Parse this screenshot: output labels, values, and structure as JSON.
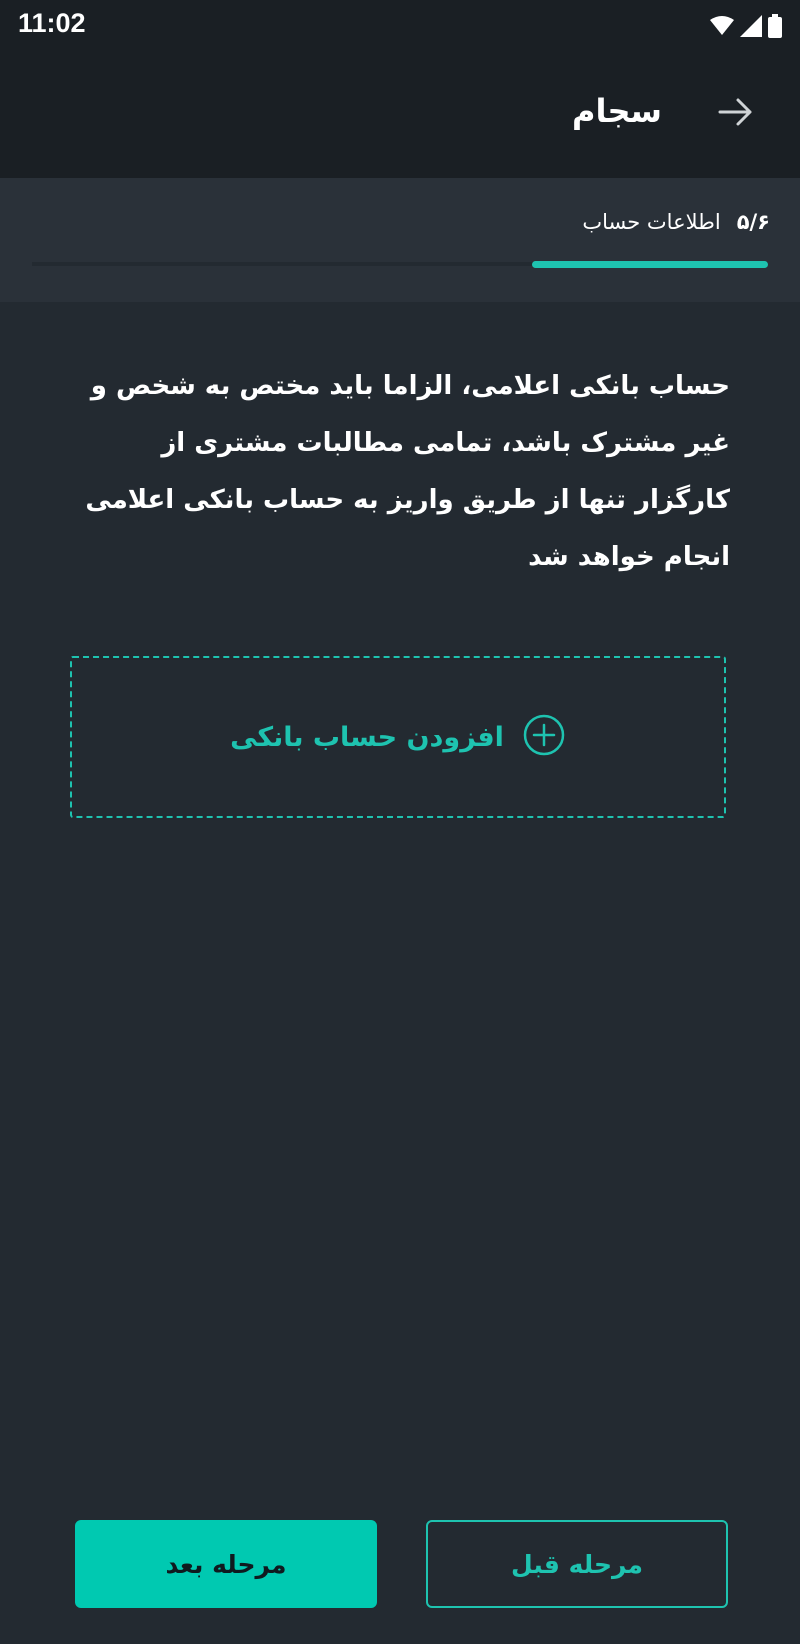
{
  "status_bar": {
    "time": "11:02"
  },
  "app_bar": {
    "title": "سجام",
    "back_icon": "arrow-right-icon"
  },
  "stepper": {
    "step_count": "۵/۶",
    "step_title": "اطلاعات حساب",
    "progress": 0.32
  },
  "description": "حساب بانکی اعلامی، الزاما باید مختص به شخص و غیر مشترک باشد، تمامی مطالبات مشتری از کارگزار تنها از طریق واریز به حساب بانکی اعلامی انجام خواهد شد",
  "add_account": {
    "label": "افزودن حساب بانکی",
    "icon": "plus-circle-icon"
  },
  "buttons": {
    "next_label": "مرحله بعد",
    "prev_label": "مرحله قبل"
  },
  "colors": {
    "accent": "#1ec3b0",
    "background": "#232a31",
    "header": "#1a1f24"
  }
}
